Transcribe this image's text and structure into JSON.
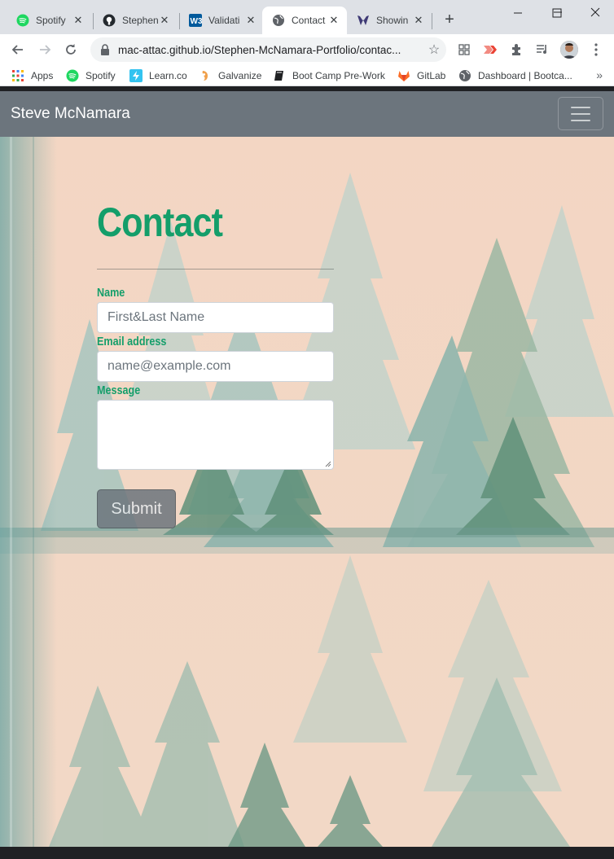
{
  "browser": {
    "tabs": [
      {
        "title": "Spotify",
        "icon": "spotify-icon",
        "active": false
      },
      {
        "title": "Stephen",
        "icon": "github-icon",
        "active": false
      },
      {
        "title": "Validati",
        "icon": "w3c-icon",
        "active": false
      },
      {
        "title": "Contact",
        "icon": "globe-icon",
        "active": true
      },
      {
        "title": "Showin",
        "icon": "site-icon",
        "active": false
      }
    ],
    "url": "mac-attac.github.io/Stephen-McNamara-Portfolio/contac...",
    "bookmarks": [
      {
        "label": "Apps",
        "icon": "apps-grid-icon"
      },
      {
        "label": "Spotify",
        "icon": "spotify-icon"
      },
      {
        "label": "Learn.co",
        "icon": "learnco-icon"
      },
      {
        "label": "Galvanize",
        "icon": "galvanize-icon"
      },
      {
        "label": "Boot Camp Pre-Work",
        "icon": "book-icon"
      },
      {
        "label": "GitLab",
        "icon": "gitlab-icon"
      },
      {
        "label": "Dashboard | Bootca...",
        "icon": "globe-icon"
      }
    ],
    "bookmarks_overflow": "»"
  },
  "navbar": {
    "brand": "Steve McNamara"
  },
  "contact": {
    "title": "Contact",
    "name_label": "Name",
    "name_placeholder": "First&Last Name",
    "email_label": "Email address",
    "email_placeholder": "name@example.com",
    "message_label": "Message",
    "message_value": "",
    "submit_label": "Submit"
  },
  "colors": {
    "accent": "#149e6a",
    "navbar": "#6c757d",
    "page_background": "#f3d9c7"
  }
}
